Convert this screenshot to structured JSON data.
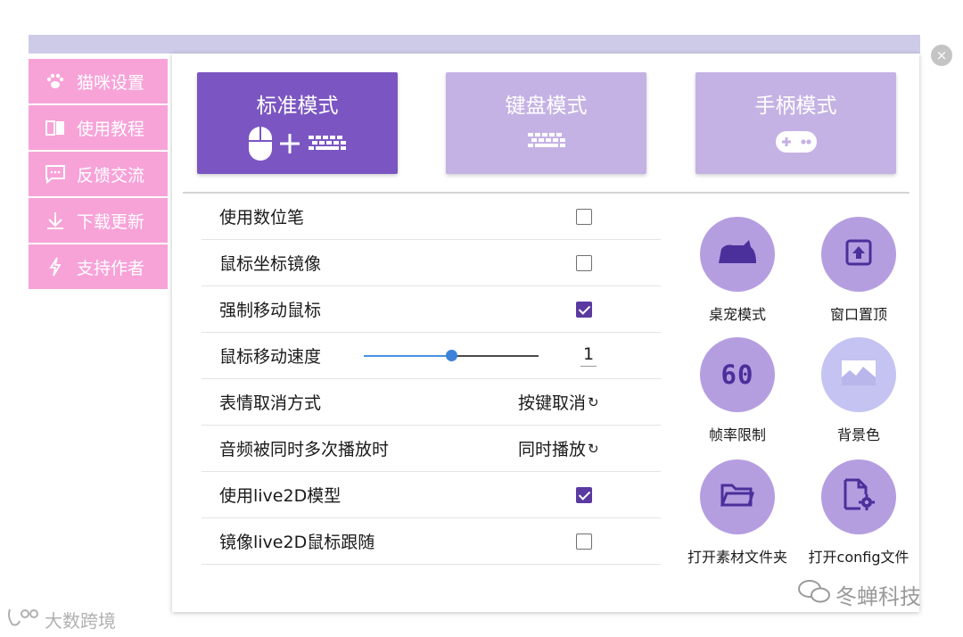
{
  "window": {
    "close_glyph": "×"
  },
  "sidebar": {
    "items": [
      {
        "label": "猫咪设置",
        "icon": "paw-icon"
      },
      {
        "label": "使用教程",
        "icon": "book-icon"
      },
      {
        "label": "反馈交流",
        "icon": "chat-icon"
      },
      {
        "label": "下载更新",
        "icon": "download-icon"
      },
      {
        "label": "支持作者",
        "icon": "lightning-icon"
      }
    ]
  },
  "modes": [
    {
      "label": "标准模式",
      "active": true,
      "icons": [
        "mouse-icon",
        "plus-icon",
        "keyboard-icon"
      ]
    },
    {
      "label": "键盘模式",
      "active": false,
      "icons": [
        "keyboard-icon"
      ]
    },
    {
      "label": "手柄模式",
      "active": false,
      "icons": [
        "gamepad-icon"
      ]
    }
  ],
  "settings": {
    "digital_pen": {
      "label": "使用数位笔",
      "checked": false
    },
    "mouse_mirror": {
      "label": "鼠标坐标镜像",
      "checked": false
    },
    "force_move": {
      "label": "强制移动鼠标",
      "checked": true
    },
    "mouse_speed": {
      "label": "鼠标移动速度",
      "value": "1",
      "slider_fraction": 0.5
    },
    "emote_cancel": {
      "label": "表情取消方式",
      "option": "按键取消",
      "cycle_glyph": "↻"
    },
    "audio_mode": {
      "label": "音频被同时多次播放时",
      "option": "同时播放",
      "cycle_glyph": "↻"
    },
    "use_live2d": {
      "label": "使用live2D模型",
      "checked": true
    },
    "mirror_live2d": {
      "label": "镜像live2D鼠标跟随",
      "checked": false
    }
  },
  "actions": {
    "pet_mode": {
      "label": "桌宠模式",
      "icon": "cat-silhouette-icon"
    },
    "window_top": {
      "label": "窗口置顶",
      "icon": "pin-top-icon"
    },
    "frame_limit": {
      "label": "帧率限制",
      "icon": "fps-60-icon",
      "icon_text": "60"
    },
    "background_color": {
      "label": "背景色",
      "icon": "landscape-icon"
    },
    "open_assets": {
      "label": "打开素材文件夹",
      "icon": "folder-icon"
    },
    "open_config": {
      "label": "打开config文件",
      "icon": "file-settings-icon"
    }
  },
  "colors": {
    "accent": "#7b56c2",
    "mode_inactive": "#c5b2e4",
    "sidebar_pink": "#f7a3d8",
    "checkbox_checked": "#5a3aa0",
    "action_circle": "#b59ee0",
    "action_circle_light": "#c5c3f2",
    "action_icon": "#4b2f9a"
  },
  "watermarks": {
    "right": "冬蝉科技",
    "left": "大数跨境"
  }
}
